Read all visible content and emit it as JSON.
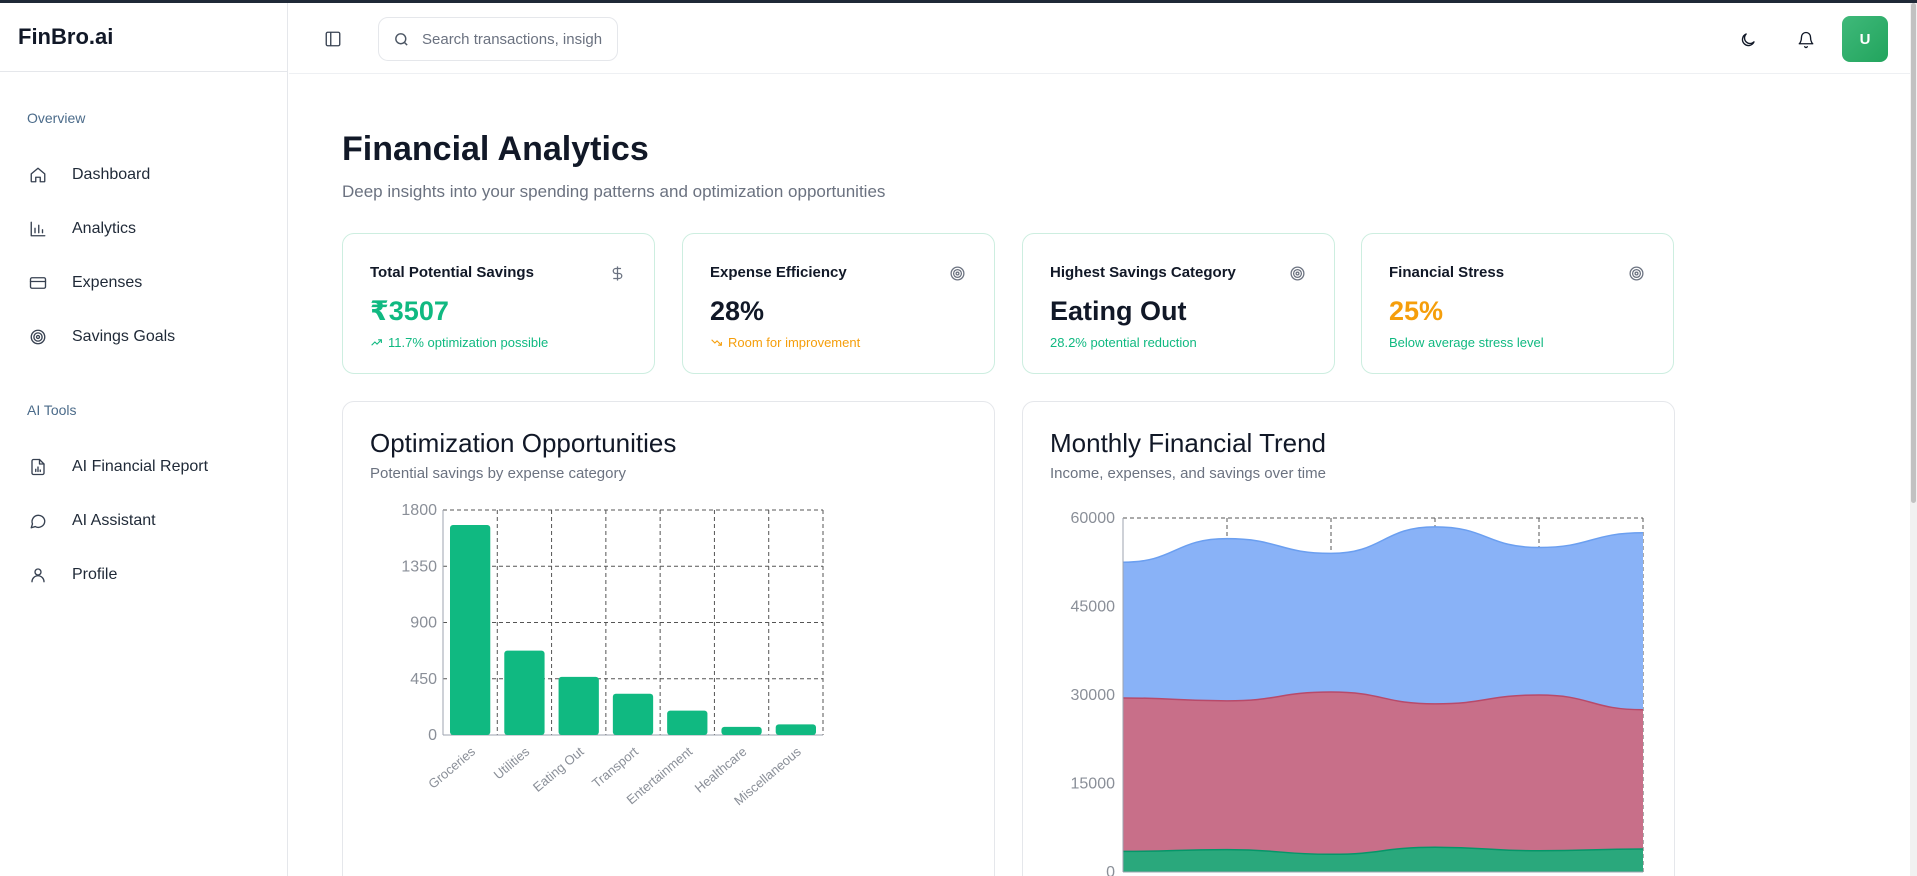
{
  "app": {
    "brand": "FinBro.ai"
  },
  "sidebar": {
    "sections": [
      {
        "label": "Overview",
        "items": [
          {
            "label": "Dashboard",
            "icon": "home-icon"
          },
          {
            "label": "Analytics",
            "icon": "bar-chart-icon"
          },
          {
            "label": "Expenses",
            "icon": "credit-card-icon"
          },
          {
            "label": "Savings Goals",
            "icon": "target-icon"
          }
        ]
      },
      {
        "label": "AI Tools",
        "items": [
          {
            "label": "AI Financial Report",
            "icon": "file-chart-icon"
          },
          {
            "label": "AI Assistant",
            "icon": "chat-bubble-icon"
          },
          {
            "label": "Profile",
            "icon": "user-icon"
          }
        ]
      }
    ]
  },
  "header": {
    "search_placeholder": "Search transactions, insights...",
    "avatar_initial": "U"
  },
  "page": {
    "title": "Financial Analytics",
    "subtitle": "Deep insights into your spending patterns and optimization opportunities"
  },
  "stats": [
    {
      "label": "Total Potential Savings",
      "value": "₹3507",
      "note": "11.7% optimization possible",
      "icon": "dollar-icon",
      "value_color": "#10b981",
      "note_color": "#10b981"
    },
    {
      "label": "Expense Efficiency",
      "value": "28%",
      "note": "Room for improvement",
      "icon": "target-icon",
      "value_color": "#111827",
      "note_color": "#f59e0b"
    },
    {
      "label": "Highest Savings Category",
      "value": "Eating Out",
      "note": "28.2% potential reduction",
      "icon": "target-icon",
      "value_color": "#111827",
      "note_color": "#10b981"
    },
    {
      "label": "Financial Stress",
      "value": "25%",
      "note": "Below average stress level",
      "icon": "target-icon",
      "value_color": "#f59e0b",
      "note_color": "#10b981"
    }
  ],
  "panels": {
    "optimization": {
      "title": "Optimization Opportunities",
      "subtitle": "Potential savings by expense category"
    },
    "trend": {
      "title": "Monthly Financial Trend",
      "subtitle": "Income, expenses, and savings over time"
    }
  },
  "chart_data": [
    {
      "type": "bar",
      "categories": [
        "Groceries",
        "Utilities",
        "Eating Out",
        "Transport",
        "Entertainment",
        "Healthcare",
        "Miscellaneous"
      ],
      "values": [
        1680,
        675,
        465,
        330,
        195,
        65,
        85
      ],
      "ylim": [
        0,
        1800
      ],
      "yticks": [
        0,
        450,
        900,
        1350,
        1800
      ],
      "grid": true,
      "color": "#10b981"
    },
    {
      "type": "area",
      "x": [
        0,
        1,
        2,
        3,
        4,
        5
      ],
      "ylim": [
        0,
        60000
      ],
      "yticks": [
        0,
        15000,
        30000,
        45000,
        60000
      ],
      "grid": true,
      "series": [
        {
          "values": [
            52500,
            56500,
            54000,
            58500,
            55000,
            57500
          ],
          "color": "#6b9ff0",
          "fill": "#89b2f7"
        },
        {
          "values": [
            29500,
            29000,
            30500,
            28500,
            30000,
            27500
          ],
          "color": "#b84a6a",
          "fill": "#c86f89"
        },
        {
          "values": [
            3500,
            3800,
            3000,
            4200,
            3600,
            3900
          ],
          "color": "#059669",
          "fill": "#2aa87c"
        }
      ]
    }
  ]
}
